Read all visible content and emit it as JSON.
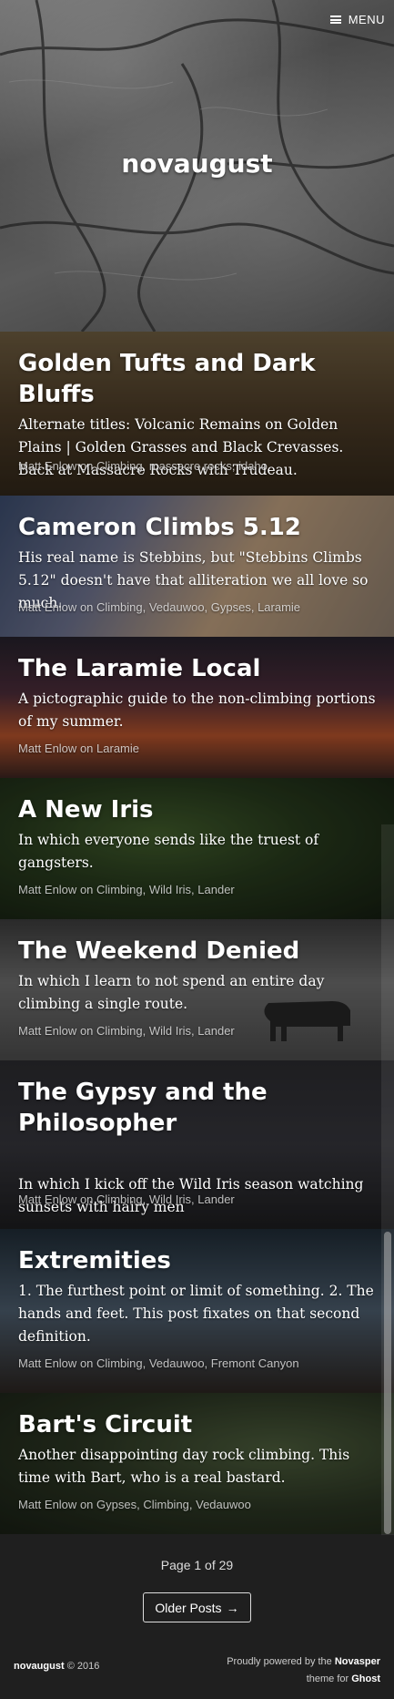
{
  "header": {
    "site_title": "novaugust",
    "menu_label": "MENU"
  },
  "posts": [
    {
      "title": "Golden Tufts and Dark Bluffs",
      "excerpt": "Alternate titles: Volcanic Remains on Golden Plains | Golden Grasses and Black Crevasses. Back at Massacre Rocks with Trudeau.",
      "author": "Matt Enlow",
      "on": "on",
      "tags": "Climbing, massacre rocks, idaho"
    },
    {
      "title": "Cameron Climbs 5.12",
      "excerpt": "His real name is Stebbins, but \"Stebbins Climbs 5.12\" doesn't have that alliteration we all love so much.",
      "author": "Matt Enlow",
      "on": "on",
      "tags": "Climbing, Vedauwoo, Gypses, Laramie"
    },
    {
      "title": "The Laramie Local",
      "excerpt": "A pictographic guide to the non-climbing portions of my summer.",
      "author": "Matt Enlow",
      "on": "on",
      "tags": "Laramie"
    },
    {
      "title": "A New Iris",
      "excerpt": "In which everyone sends like the truest of gangsters.",
      "author": "Matt Enlow",
      "on": "on",
      "tags": "Climbing, Wild Iris, Lander"
    },
    {
      "title": "The Weekend Denied",
      "excerpt": "In which I learn to not spend an entire day climbing a single route.",
      "author": "Matt Enlow",
      "on": "on",
      "tags": "Climbing, Wild Iris, Lander"
    },
    {
      "title": "The Gypsy and the Philosopher",
      "excerpt": "In which I kick off the Wild Iris season watching sunsets with hairy men",
      "author": "Matt Enlow",
      "on": "on",
      "tags": "Climbing, Wild Iris, Lander"
    },
    {
      "title": "Extremities",
      "excerpt": "1. The furthest point or limit of something. 2. The hands and feet. This post fixates on that second definition.",
      "author": "Matt Enlow",
      "on": "on",
      "tags": "Climbing, Vedauwoo, Fremont Canyon"
    },
    {
      "title": "Bart's Circuit",
      "excerpt": "Another disappointing day rock climbing. This time with Bart, who is a real bastard.",
      "author": "Matt Enlow",
      "on": "on",
      "tags": "Gypses, Climbing, Vedauwoo"
    }
  ],
  "pagination": {
    "text": "Page 1 of 29",
    "older_label": "Older Posts",
    "older_arrow": "→"
  },
  "footer": {
    "site_name": "novaugust",
    "copyright": "© 2016",
    "powered_prefix": "Proudly powered by the",
    "theme_name": "Novasper",
    "theme_for": "theme for",
    "platform": "Ghost"
  }
}
